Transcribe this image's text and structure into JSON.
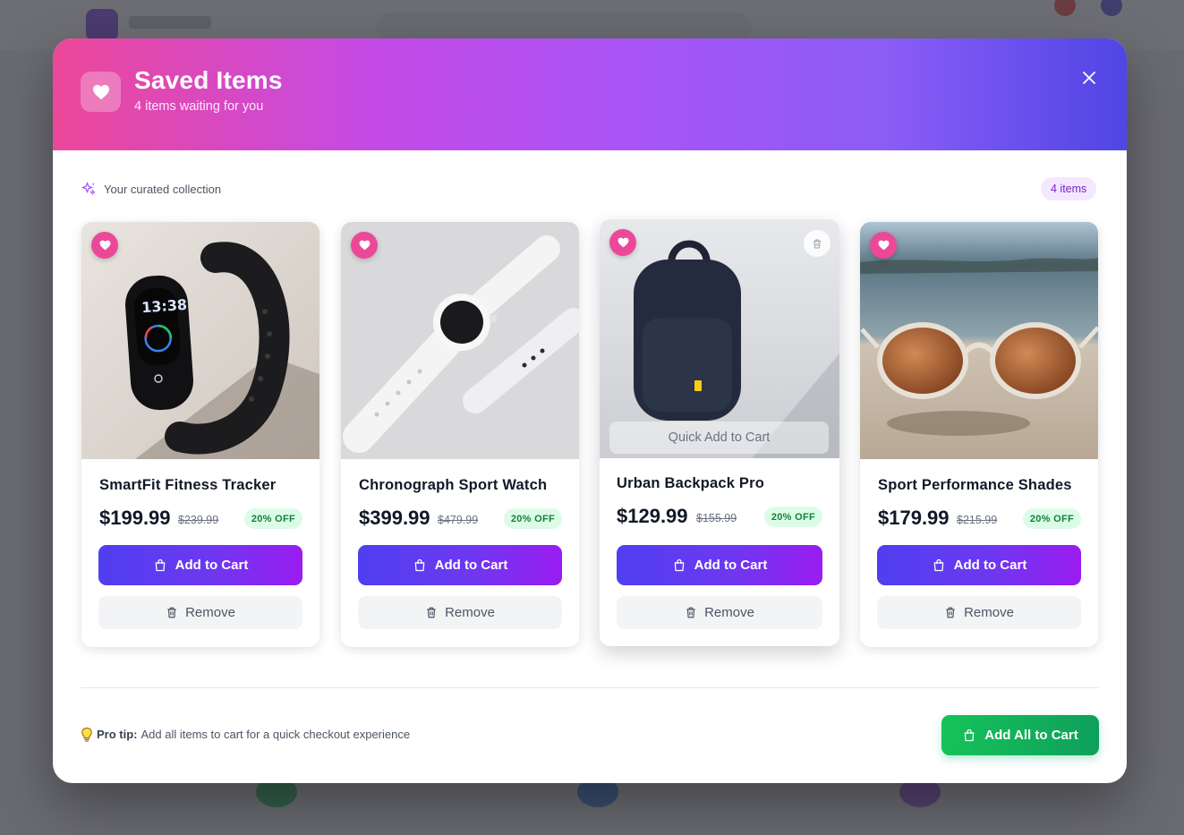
{
  "modal": {
    "title": "Saved Items",
    "subtitle": "4 items waiting for you",
    "collection_label": "Your curated collection",
    "count_badge": "4 items",
    "quick_add_label": "Quick Add to Cart",
    "pro_tip_label": "Pro tip:",
    "pro_tip_text": "Add all items to cart for a quick checkout experience",
    "add_all_label": "Add All to Cart"
  },
  "items": [
    {
      "name": "SmartFit Fitness Tracker",
      "price": "$199.99",
      "old_price": "$239.99",
      "discount": "20% OFF",
      "add_label": "Add to Cart",
      "remove_label": "Remove",
      "image": "fitness-tracker-photo"
    },
    {
      "name": "Chronograph Sport Watch",
      "price": "$399.99",
      "old_price": "$479.99",
      "discount": "20% OFF",
      "add_label": "Add to Cart",
      "remove_label": "Remove",
      "image": "sport-watch-photo"
    },
    {
      "name": "Urban Backpack Pro",
      "price": "$129.99",
      "old_price": "$155.99",
      "discount": "20% OFF",
      "add_label": "Add to Cart",
      "remove_label": "Remove",
      "image": "backpack-photo"
    },
    {
      "name": "Sport Performance Shades",
      "price": "$179.99",
      "old_price": "$215.99",
      "discount": "20% OFF",
      "add_label": "Add to Cart",
      "remove_label": "Remove",
      "image": "sunglasses-photo"
    }
  ],
  "colors": {
    "header_gradient": [
      "#ec4899",
      "#a855f7",
      "#4f46e5"
    ],
    "heart": "#ec4899",
    "primary_button": "#6d38f0",
    "discount_bg": "#dcfce7",
    "discount_text": "#15803d",
    "add_all_button": "#10b058",
    "badge_bg": "#f3e8ff",
    "badge_text": "#7e22ce"
  },
  "icons": {
    "header": "heart-icon",
    "close": "close-icon",
    "collection": "sparkles-icon",
    "card_favorite": "heart-icon",
    "add_to_cart": "shopping-bag-icon",
    "remove": "trash-icon",
    "pro_tip": "lightbulb-icon"
  }
}
